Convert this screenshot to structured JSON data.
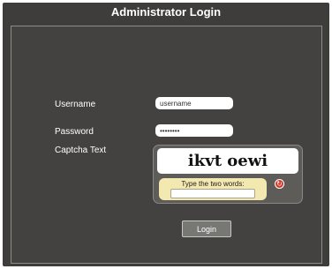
{
  "title": "Administrator Login",
  "form": {
    "username_label": "Username",
    "username_value": "username",
    "password_label": "Password",
    "password_value": "••••••••",
    "captcha_label": "Captcha Text",
    "captcha_words": "ikvt oewi",
    "captcha_hint": "Type the two words:",
    "captcha_value": "",
    "refresh_icon": "refresh-icon",
    "login_label": "Login"
  }
}
